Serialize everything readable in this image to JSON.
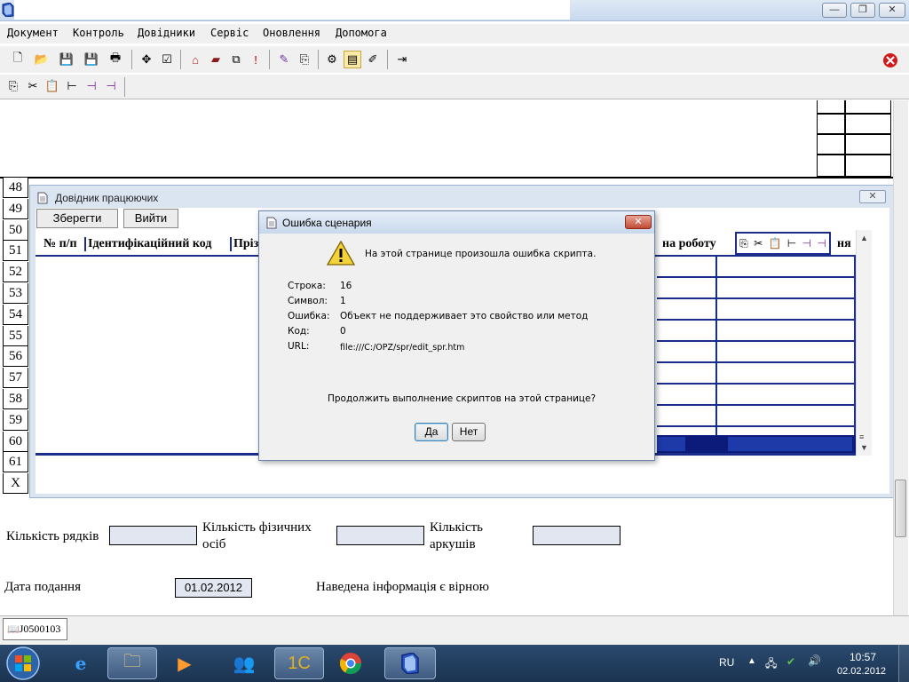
{
  "menu": [
    "Документ",
    "Контроль",
    "Довідники",
    "Сервіс",
    "Оновлення",
    "Допомога"
  ],
  "window_buttons": {
    "minimize": "—",
    "restore": "❐",
    "close": "✕"
  },
  "document": {
    "row_numbers": [
      "48",
      "49",
      "50",
      "51",
      "52",
      "53",
      "54",
      "55",
      "56",
      "57",
      "58",
      "59",
      "60",
      "61",
      "X"
    ]
  },
  "employee_dialog": {
    "title": "Довідник працюючих",
    "save_label": "Зберегти",
    "exit_label": "Вийти",
    "columns": [
      "№ п/п",
      "Ідентифікаційний код",
      "Прізв",
      "на роботу",
      "ня"
    ]
  },
  "error_dialog": {
    "title": "Ошибка сценария",
    "message": "На этой странице произошла ошибка скрипта.",
    "details": [
      {
        "label": "Строка:",
        "value": "16"
      },
      {
        "label": "Символ:",
        "value": "1"
      },
      {
        "label": "Ошибка:",
        "value": "Объект не поддерживает это свойство или метод"
      },
      {
        "label": "Код:",
        "value": "0"
      },
      {
        "label": "URL:",
        "value": "file:///C:/OPZ/spr/edit_spr.htm"
      }
    ],
    "question": "Продолжить выполнение скриптов на этой странице?",
    "yes_label": "Да",
    "no_label": "Нет"
  },
  "form": {
    "rows_label": "Кількість рядків",
    "persons_label": "Кількість фізичних осіб",
    "sheets_label": "Кількість аркушів",
    "date_label": "Дата подання",
    "date_value": "01.02.2012",
    "confirm_text": "Наведена інформація є вірною"
  },
  "doc_tab": "J0500103",
  "taskbar": {
    "language": "RU",
    "time": "10:57",
    "date": "02.02.2012"
  }
}
